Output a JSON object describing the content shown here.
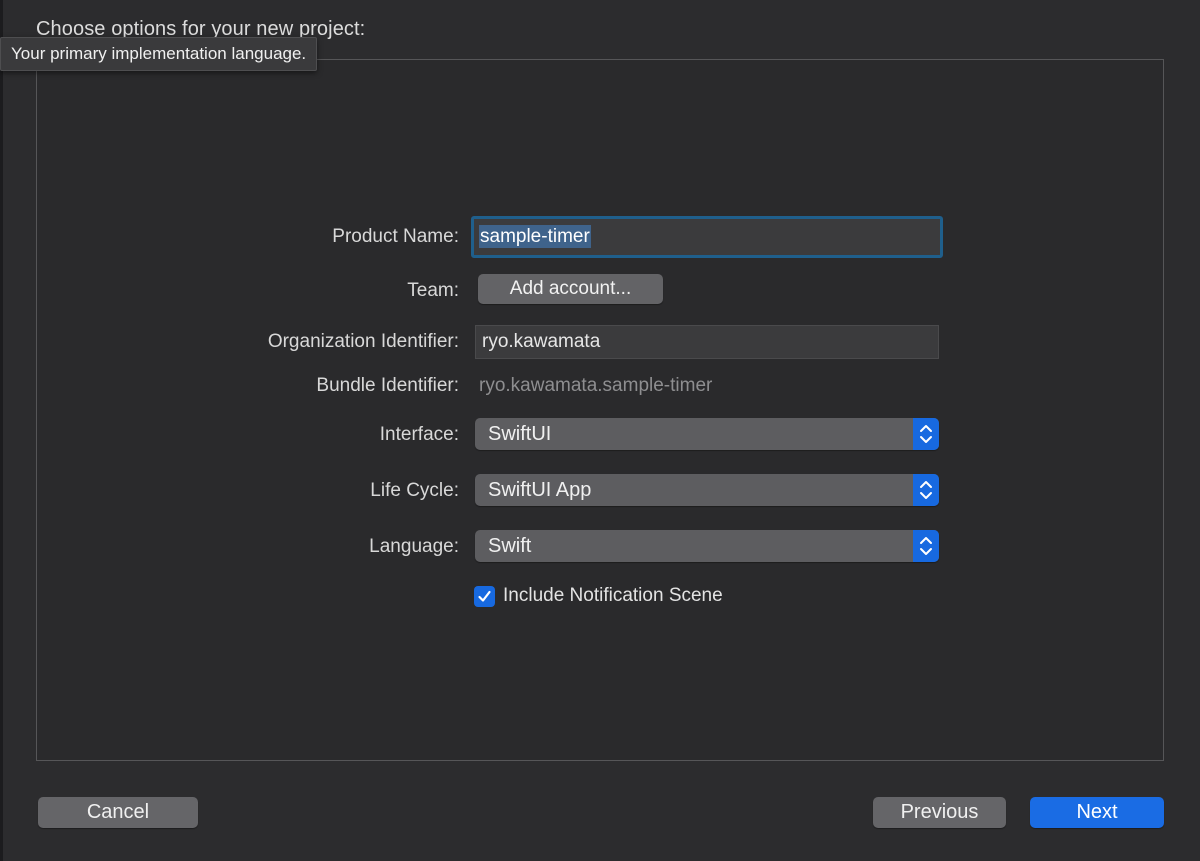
{
  "header": {
    "title": "Choose options for your new project:"
  },
  "tooltip": {
    "text": "Your primary implementation language."
  },
  "form": {
    "product_name": {
      "label": "Product Name:",
      "value": "sample-timer"
    },
    "team": {
      "label": "Team:",
      "button_label": "Add account..."
    },
    "organization_identifier": {
      "label": "Organization Identifier:",
      "value": "ryo.kawamata"
    },
    "bundle_identifier": {
      "label": "Bundle Identifier:",
      "value": "ryo.kawamata.sample-timer"
    },
    "interface": {
      "label": "Interface:",
      "selected": "SwiftUI"
    },
    "life_cycle": {
      "label": "Life Cycle:",
      "selected": "SwiftUI App"
    },
    "language": {
      "label": "Language:",
      "selected": "Swift"
    },
    "include_notification_scene": {
      "label": "Include Notification Scene",
      "checked": true
    }
  },
  "footer": {
    "cancel_label": "Cancel",
    "previous_label": "Previous",
    "next_label": "Next"
  },
  "colors": {
    "accent": "#1a6ce4",
    "focus_ring": "#1f5f8c",
    "selection": "#3f638b",
    "background": "#2c2c2e"
  },
  "icons": {
    "popup_stepper": "chevron-up-down-icon",
    "checkbox": "checkmark-icon"
  }
}
